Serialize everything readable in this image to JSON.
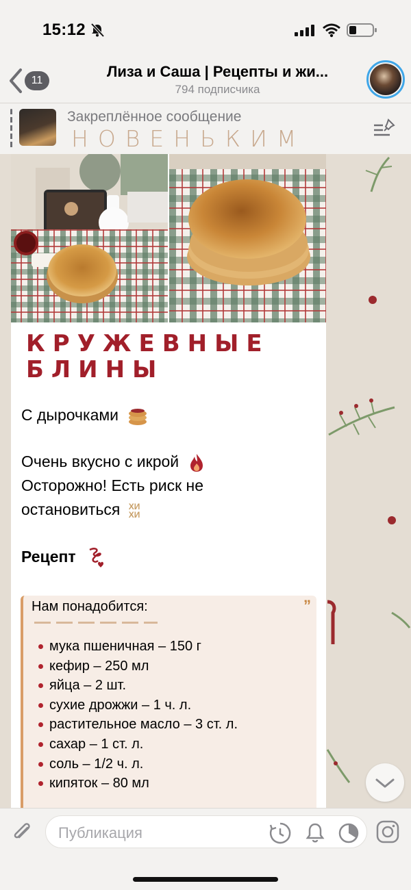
{
  "status": {
    "time": "15:12"
  },
  "header": {
    "unread_count": "11",
    "title": "Лиза и Саша | Рецепты и жи...",
    "subtitle": "794 подписчика"
  },
  "pinned": {
    "label": "Закреплённое сообщение",
    "text": "НОВЕНЬКИМ"
  },
  "message": {
    "heading_line1": "КРУЖЕВНЫЕ",
    "heading_line2": "БЛИНЫ",
    "line1": "С дырочками",
    "line2": "Очень вкусно с икрой",
    "line3": "Осторожно! Есть риск не",
    "line4": "остановиться",
    "recipe_title": "Рецепт",
    "quote": {
      "title": "Нам понадобится:",
      "ingredients": [
        "мука пшеничная – 150 г",
        "кефир – 250 мл",
        "яйца – 2 шт.",
        "сухие дрожжи – 1 ч. л.",
        "растительное масло – 3 ст. л.",
        "сахар – 1 ст. л.",
        "соль – 1/2 ч. л.",
        "кипяток  – 80 мл"
      ]
    },
    "emoji_text": "ХИ ХИ"
  },
  "composer": {
    "placeholder": "Публикация"
  },
  "colors": {
    "accent": "#3fa6e8",
    "heading": "#a11f2a",
    "quote_bar": "#d99d68",
    "bullet": "#b0232e"
  }
}
